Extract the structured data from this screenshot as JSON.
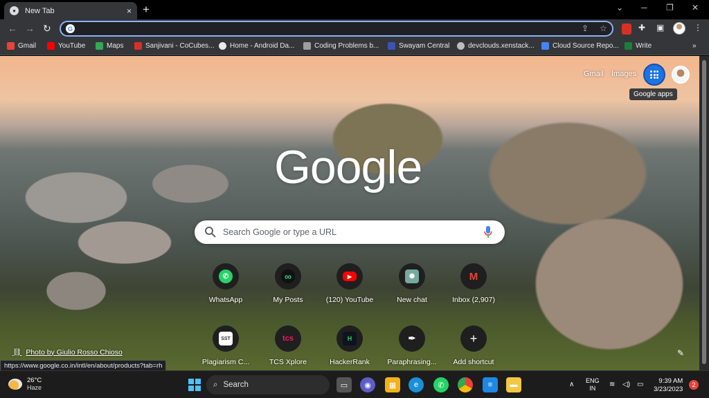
{
  "tab": {
    "title": "New Tab",
    "close_glyph": "×"
  },
  "window": {
    "new_tab_glyph": "+",
    "minimize_glyph": "⌄",
    "restore_glyph": "─",
    "maximize_glyph": "❐",
    "close_glyph": "✕"
  },
  "omnibox": {
    "value": "",
    "g_letter": "G"
  },
  "bookmarks": [
    {
      "label": "Gmail",
      "color": "#ea4335"
    },
    {
      "label": "YouTube",
      "color": "#ff0000"
    },
    {
      "label": "Maps",
      "color": "#34a853"
    },
    {
      "label": "Sanjivani - CoCubes...",
      "color": "#d93025"
    },
    {
      "label": "Home - Android Da...",
      "color": "#e8eaed"
    },
    {
      "label": "Coding Problems b...",
      "color": "#9e9e9e"
    },
    {
      "label": "Swayam Central",
      "color": "#3f51b5"
    },
    {
      "label": "devclouds.xenstack...",
      "color": "#bdbdbd"
    },
    {
      "label": "Cloud Source Repo...",
      "color": "#4285f4"
    },
    {
      "label": "Write",
      "color": "#188038"
    }
  ],
  "header": {
    "gmail": "Gmail",
    "images": "Images",
    "apps_tooltip": "Google apps"
  },
  "logo": "Google",
  "search": {
    "placeholder": "Search Google or type a URL"
  },
  "shortcuts": [
    {
      "label": "WhatsApp",
      "icon": "whatsapp-icon",
      "color": "#25d366",
      "glyph": "✆"
    },
    {
      "label": "My Posts",
      "icon": "my-posts-icon",
      "color": "#2bd47e",
      "glyph": "∞"
    },
    {
      "label": "(120) YouTube",
      "icon": "youtube-icon",
      "color": "#ff0000",
      "glyph": "▶"
    },
    {
      "label": "New chat",
      "icon": "openai-icon",
      "color": "#74aa9c",
      "glyph": "✺"
    },
    {
      "label": "Inbox (2,907)",
      "icon": "gmail-icon",
      "color": "#ea4335",
      "glyph": "M"
    },
    {
      "label": "Plagiarism C...",
      "icon": "plagiarism-icon",
      "color": "#ffffff",
      "glyph": "SST"
    },
    {
      "label": "TCS Xplore",
      "icon": "tcs-icon",
      "color": "#e91e63",
      "glyph": "tcs"
    },
    {
      "label": "HackerRank",
      "icon": "hackerrank-icon",
      "color": "#2ec866",
      "glyph": "H"
    },
    {
      "label": "Paraphrasing...",
      "icon": "quill-icon",
      "color": "#ffffff",
      "glyph": "✒"
    },
    {
      "label": "Add shortcut",
      "icon": "plus-icon",
      "color": "#ffffff",
      "glyph": "+"
    }
  ],
  "photo_credit": "Photo by Giulio Rosso Chioso",
  "status_url": "https://www.google.co.in/intl/en/about/products?tab=rh",
  "taskbar": {
    "temp": "26°C",
    "weather": "Haze",
    "search_label": "Search",
    "lang_top": "ENG",
    "lang_bottom": "IN",
    "time": "9:39 AM",
    "date": "3/23/2023",
    "notifications": "2"
  }
}
